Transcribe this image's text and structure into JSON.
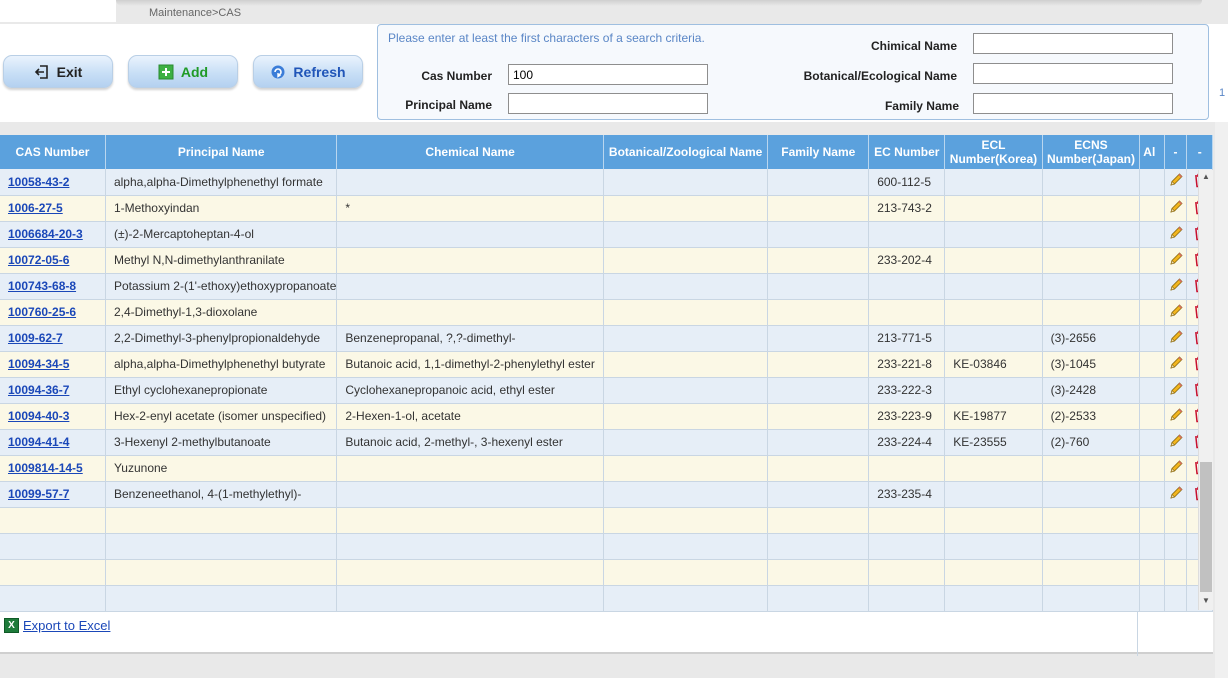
{
  "breadcrumb": "Maintenance>CAS",
  "toolbar": {
    "exit_label": "Exit",
    "add_label": "Add",
    "refresh_label": "Refresh"
  },
  "search": {
    "hint": "Please enter at least the first characters of a search criteria.",
    "cas_label": "Cas Number",
    "cas_value": "100",
    "principal_label": "Principal Name",
    "principal_value": "",
    "chemical_label": "Chimical Name",
    "chemical_value": "",
    "botanical_label": "Botanical/Ecological Name",
    "botanical_value": "",
    "family_label": "Family Name",
    "family_value": "",
    "edge_digit": "1"
  },
  "grid": {
    "columns": [
      "CAS Number",
      "Principal Name",
      "Chemical Name",
      "Botanical/Zoological Name",
      "Family Name",
      "EC Number",
      "ECL Number(Korea)",
      "ECNS Number(Japan)",
      "Al",
      "-",
      "-"
    ],
    "rows": [
      {
        "cas": "10058-43-2",
        "principal": "alpha,alpha-Dimethylphenethyl formate",
        "chemical": "",
        "botanical": "",
        "family": "",
        "ec": "600-112-5",
        "ecl": "",
        "ecns": ""
      },
      {
        "cas": "1006-27-5",
        "principal": "1-Methoxyindan",
        "chemical": "*",
        "botanical": "",
        "family": "",
        "ec": "213-743-2",
        "ecl": "",
        "ecns": ""
      },
      {
        "cas": "1006684-20-3",
        "principal": "(±)-2-Mercaptoheptan-4-ol",
        "chemical": "",
        "botanical": "",
        "family": "",
        "ec": "",
        "ecl": "",
        "ecns": ""
      },
      {
        "cas": "10072-05-6",
        "principal": "Methyl N,N-dimethylanthranilate",
        "chemical": "",
        "botanical": "",
        "family": "",
        "ec": "233-202-4",
        "ecl": "",
        "ecns": ""
      },
      {
        "cas": "100743-68-8",
        "principal": "Potassium 2-(1'-ethoxy)ethoxypropanoate",
        "chemical": "",
        "botanical": "",
        "family": "",
        "ec": "",
        "ecl": "",
        "ecns": ""
      },
      {
        "cas": "100760-25-6",
        "principal": "2,4-Dimethyl-1,3-dioxolane",
        "chemical": "",
        "botanical": "",
        "family": "",
        "ec": "",
        "ecl": "",
        "ecns": ""
      },
      {
        "cas": "1009-62-7",
        "principal": "2,2-Dimethyl-3-phenylpropionaldehyde",
        "chemical": "Benzenepropanal, ?,?-dimethyl-",
        "botanical": "",
        "family": "",
        "ec": "213-771-5",
        "ecl": "",
        "ecns": "(3)-2656"
      },
      {
        "cas": "10094-34-5",
        "principal": "alpha,alpha-Dimethylphenethyl butyrate",
        "chemical": "Butanoic acid, 1,1-dimethyl-2-phenylethyl ester",
        "botanical": "",
        "family": "",
        "ec": "233-221-8",
        "ecl": "KE-03846",
        "ecns": "(3)-1045"
      },
      {
        "cas": "10094-36-7",
        "principal": "Ethyl cyclohexanepropionate",
        "chemical": "Cyclohexanepropanoic acid, ethyl ester",
        "botanical": "",
        "family": "",
        "ec": "233-222-3",
        "ecl": "",
        "ecns": "(3)-2428"
      },
      {
        "cas": "10094-40-3",
        "principal": "Hex-2-enyl acetate (isomer unspecified)",
        "chemical": "2-Hexen-1-ol, acetate",
        "botanical": "",
        "family": "",
        "ec": "233-223-9",
        "ecl": "KE-19877",
        "ecns": "(2)-2533"
      },
      {
        "cas": "10094-41-4",
        "principal": "3-Hexenyl 2-methylbutanoate",
        "chemical": "Butanoic acid, 2-methyl-, 3-hexenyl ester",
        "botanical": "",
        "family": "",
        "ec": "233-224-4",
        "ecl": "KE-23555",
        "ecns": "(2)-760"
      },
      {
        "cas": "1009814-14-5",
        "principal": "Yuzunone",
        "chemical": "",
        "botanical": "",
        "family": "",
        "ec": "",
        "ecl": "",
        "ecns": ""
      },
      {
        "cas": "10099-57-7",
        "principal": "Benzeneethanol, 4-(1-methylethyl)-",
        "chemical": "",
        "botanical": "",
        "family": "",
        "ec": "233-235-4",
        "ecl": "",
        "ecns": ""
      }
    ],
    "empty_rows": 4
  },
  "footer": {
    "export_label": "Export to Excel",
    "excel_icon_letter": "X"
  },
  "colors": {
    "header_blue": "#5ba1dd",
    "link_blue": "#1a47b8",
    "row_blue": "#e6eef7",
    "row_cream": "#fbf8e6",
    "delete_red": "#c8102e"
  }
}
